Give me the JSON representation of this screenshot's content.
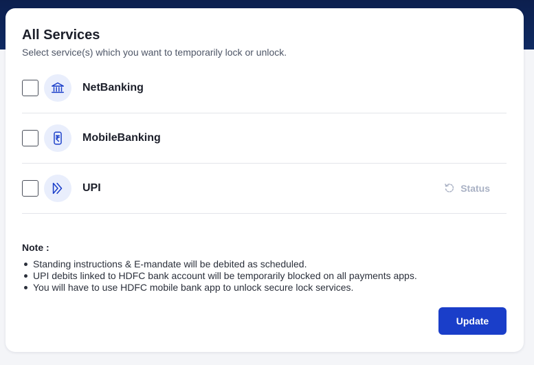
{
  "card": {
    "title": "All Services",
    "subtitle": "Select service(s) which you want to temporarily lock or unlock."
  },
  "services": [
    {
      "label": "NetBanking",
      "icon": "bank-icon",
      "checked": false
    },
    {
      "label": "MobileBanking",
      "icon": "mobile-rupee-icon",
      "checked": false
    },
    {
      "label": "UPI",
      "icon": "upi-icon",
      "checked": false,
      "status_label": "Status",
      "status_icon": "refresh-icon"
    }
  ],
  "note": {
    "title": "Note :",
    "items": [
      "Standing instructions & E-mandate will be debited as scheduled.",
      "UPI debits linked to HDFC bank account will be temporarily blocked on all payments apps.",
      "You will have to use HDFC mobile bank app to unlock secure lock services."
    ]
  },
  "actions": {
    "update_label": "Update"
  },
  "colors": {
    "header_band": "#0f2a62",
    "primary_button": "#1a3ec9",
    "icon_circle": "#e9eefc",
    "icon_stroke": "#1a3ec9",
    "status_text": "#a9b1c4"
  }
}
